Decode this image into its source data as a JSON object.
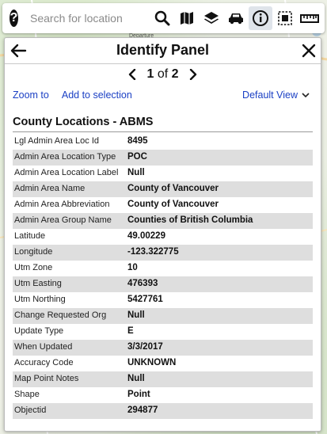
{
  "search": {
    "placeholder": "Search for location"
  },
  "toolbar": {
    "help_label": "?",
    "icons": [
      "search-icon",
      "map-icon",
      "layers-icon",
      "car-icon",
      "info-icon",
      "select-region-icon",
      "ruler-icon"
    ],
    "active_icon": "info-icon"
  },
  "panel": {
    "title": "Identify Panel",
    "pager": {
      "current": "1",
      "of_label": "of",
      "total": "2"
    },
    "actions": {
      "zoom_to": "Zoom to",
      "add_to_selection": "Add to selection",
      "view": "Default View"
    },
    "section_title": "County Locations - ABMS",
    "attributes": [
      {
        "key": "Lgl Admin Area Loc Id",
        "value": "8495"
      },
      {
        "key": "Admin Area Location Type",
        "value": "POC"
      },
      {
        "key": "Admin Area Location Label",
        "value": "Null"
      },
      {
        "key": "Admin Area Name",
        "value": "County of Vancouver"
      },
      {
        "key": "Admin Area Abbreviation",
        "value": "County of Vancouver"
      },
      {
        "key": "Admin Area Group Name",
        "value": "Counties of British Columbia"
      },
      {
        "key": "Latitude",
        "value": "49.00229"
      },
      {
        "key": "Longitude",
        "value": "-123.322775"
      },
      {
        "key": "Utm Zone",
        "value": "10"
      },
      {
        "key": "Utm Easting",
        "value": "476393"
      },
      {
        "key": "Utm Northing",
        "value": "5427761"
      },
      {
        "key": "Change Requested Org",
        "value": "Null"
      },
      {
        "key": "Update Type",
        "value": "E"
      },
      {
        "key": "When Updated",
        "value": "3/3/2017"
      },
      {
        "key": "Accuracy Code",
        "value": "UNKNOWN"
      },
      {
        "key": "Map Point Notes",
        "value": "Null"
      },
      {
        "key": "Shape",
        "value": "Point"
      },
      {
        "key": "Objectid",
        "value": "294877"
      }
    ]
  },
  "map": {
    "visible_label": "Departure"
  },
  "colors": {
    "link": "#1a3fc4",
    "row_alt": "#dedede",
    "active_icon_bg": "#dfe4ea"
  }
}
